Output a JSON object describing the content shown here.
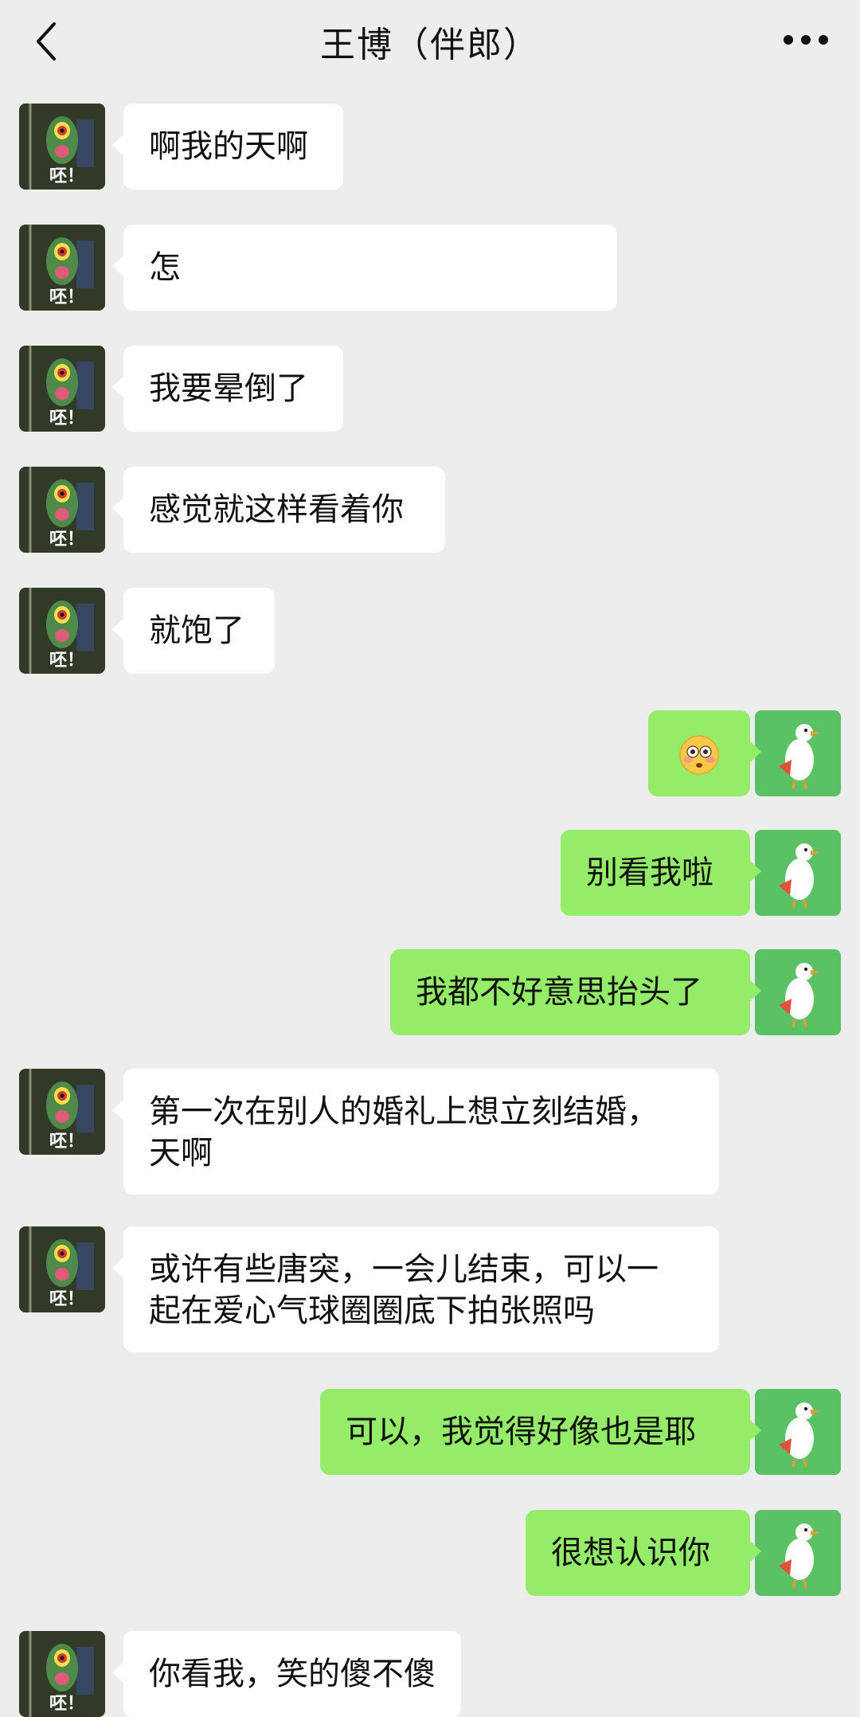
{
  "header": {
    "title": "王博（伴郎）"
  },
  "messages": [
    {
      "side": "left",
      "text": "啊我的天啊"
    },
    {
      "side": "left",
      "text": "怎"
    },
    {
      "side": "left",
      "text": "我要晕倒了"
    },
    {
      "side": "left",
      "text": "感觉就这样看着你"
    },
    {
      "side": "left",
      "text": "就饱了"
    },
    {
      "side": "right",
      "emoji": "flushed-face"
    },
    {
      "side": "right",
      "text": "别看我啦"
    },
    {
      "side": "right",
      "text": "我都不好意思抬头了"
    },
    {
      "side": "left",
      "text": "第一次在别人的婚礼上想立刻结婚，\n天啊"
    },
    {
      "side": "left",
      "text": "或许有些唐突，一会儿结束，可以一\n起在爱心气球圈圈底下拍张照吗"
    },
    {
      "side": "right",
      "text": "可以，我觉得好像也是耶"
    },
    {
      "side": "right",
      "text": "很想认识你"
    },
    {
      "side": "left",
      "text": "你看我，笑的傻不傻"
    }
  ],
  "avatars": {
    "left": {
      "caption": "呸！"
    }
  },
  "colors": {
    "background": "#ededed",
    "bubble_left": "#ffffff",
    "bubble_right": "#95ec69"
  }
}
